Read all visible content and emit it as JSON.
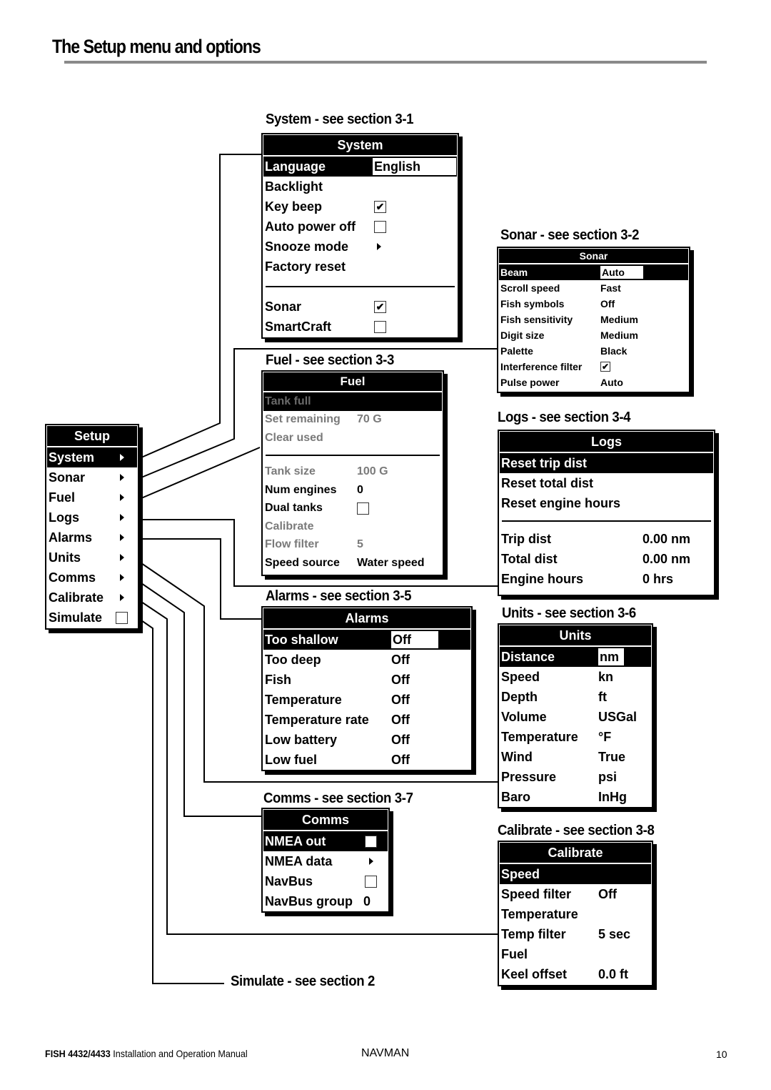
{
  "page": {
    "title": "The Setup menu and options",
    "footer": {
      "model": "FISH 4432/4433",
      "manual": "Installation and Operation Manual",
      "brand": "NAVMAN",
      "page_number": "10"
    }
  },
  "setup": {
    "header": "Setup",
    "items": [
      {
        "label": "System",
        "selected": true,
        "submenu": true
      },
      {
        "label": "Sonar",
        "submenu": true
      },
      {
        "label": "Fuel",
        "submenu": true
      },
      {
        "label": "Logs",
        "submenu": true
      },
      {
        "label": "Alarms",
        "submenu": true
      },
      {
        "label": "Units",
        "submenu": true
      },
      {
        "label": "Comms",
        "submenu": true
      },
      {
        "label": "Calibrate",
        "submenu": true
      },
      {
        "label": "Simulate",
        "checkbox": false
      }
    ]
  },
  "system": {
    "section_label": "System - see section 3-1",
    "header": "System",
    "items": [
      {
        "label": "Language",
        "value": "English",
        "selected": true
      },
      {
        "label": "Backlight"
      },
      {
        "label": "Key beep",
        "checkbox": true
      },
      {
        "label": "Auto power off",
        "checkbox": false
      },
      {
        "label": "Snooze mode",
        "submenu": true
      },
      {
        "label": "Factory reset"
      },
      {
        "label": "Sonar",
        "checkbox": true
      },
      {
        "label": "SmartCraft",
        "checkbox": false
      }
    ]
  },
  "sonar": {
    "section_label": "Sonar - see section 3-2",
    "header": "Sonar",
    "items": [
      {
        "label": "Beam",
        "value": "Auto",
        "selected": true
      },
      {
        "label": "Scroll speed",
        "value": "Fast"
      },
      {
        "label": "Fish symbols",
        "value": "Off"
      },
      {
        "label": "Fish sensitivity",
        "value": "Medium"
      },
      {
        "label": "Digit size",
        "value": "Medium"
      },
      {
        "label": "Palette",
        "value": "Black"
      },
      {
        "label": "Interference filter",
        "checkbox": true
      },
      {
        "label": "Pulse power",
        "value": "Auto"
      }
    ]
  },
  "fuel": {
    "section_label": "Fuel - see section 3-3",
    "header": "Fuel",
    "items": [
      {
        "label": "Tank full",
        "selected": true,
        "disabled": true
      },
      {
        "label": "Set remaining",
        "value": "70 G",
        "disabled": true
      },
      {
        "label": "Clear used",
        "disabled": true
      },
      {
        "label": "Tank size",
        "value": "100 G",
        "disabled": true
      },
      {
        "label": "Num engines",
        "value": "0"
      },
      {
        "label": "Dual tanks",
        "checkbox": false
      },
      {
        "label": "Calibrate",
        "disabled": true
      },
      {
        "label": "Flow filter",
        "value": "5",
        "disabled": true
      },
      {
        "label": "Speed source",
        "value": "Water speed"
      }
    ]
  },
  "logs": {
    "section_label": "Logs - see section 3-4",
    "header": "Logs",
    "items": [
      {
        "label": "Reset trip dist",
        "selected": true
      },
      {
        "label": "Reset total dist"
      },
      {
        "label": "Reset engine hours"
      },
      {
        "label": "Trip dist",
        "value": "0.00 nm"
      },
      {
        "label": "Total dist",
        "value": "0.00 nm"
      },
      {
        "label": "Engine hours",
        "value": "0 hrs"
      }
    ]
  },
  "alarms": {
    "section_label": "Alarms - see section 3-5",
    "header": "Alarms",
    "items": [
      {
        "label": "Too shallow",
        "value": "Off",
        "selected": true
      },
      {
        "label": "Too deep",
        "value": "Off"
      },
      {
        "label": "Fish",
        "value": "Off"
      },
      {
        "label": "Temperature",
        "value": "Off"
      },
      {
        "label": "Temperature rate",
        "value": "Off"
      },
      {
        "label": "Low battery",
        "value": "Off"
      },
      {
        "label": "Low fuel",
        "value": "Off"
      }
    ]
  },
  "units": {
    "section_label": "Units - see section 3-6",
    "header": "Units",
    "items": [
      {
        "label": "Distance",
        "value": "nm",
        "selected": true
      },
      {
        "label": "Speed",
        "value": "kn"
      },
      {
        "label": "Depth",
        "value": "ft"
      },
      {
        "label": "Volume",
        "value": "USGal"
      },
      {
        "label": "Temperature",
        "value": "°F"
      },
      {
        "label": "Wind",
        "value": "True"
      },
      {
        "label": "Pressure",
        "value": "psi"
      },
      {
        "label": "Baro",
        "value": "InHg"
      }
    ]
  },
  "comms": {
    "section_label": "Comms - see section 3-7",
    "header": "Comms",
    "items": [
      {
        "label": "NMEA out",
        "checkbox": false,
        "selected": true
      },
      {
        "label": "NMEA data",
        "submenu": true
      },
      {
        "label": "NavBus",
        "checkbox": false
      },
      {
        "label": "NavBus group",
        "value": "0"
      }
    ]
  },
  "calibrate": {
    "section_label": "Calibrate - see section 3-8",
    "header": "Calibrate",
    "items": [
      {
        "label": "Speed",
        "selected": true
      },
      {
        "label": "Speed filter",
        "value": "Off"
      },
      {
        "label": "Temperature"
      },
      {
        "label": "Temp filter",
        "value": "5 sec"
      },
      {
        "label": "Fuel"
      },
      {
        "label": "Keel offset",
        "value": "0.0 ft"
      }
    ]
  },
  "simulate": {
    "section_label": "Simulate - see section 2"
  },
  "icons": {
    "check": "✔"
  }
}
